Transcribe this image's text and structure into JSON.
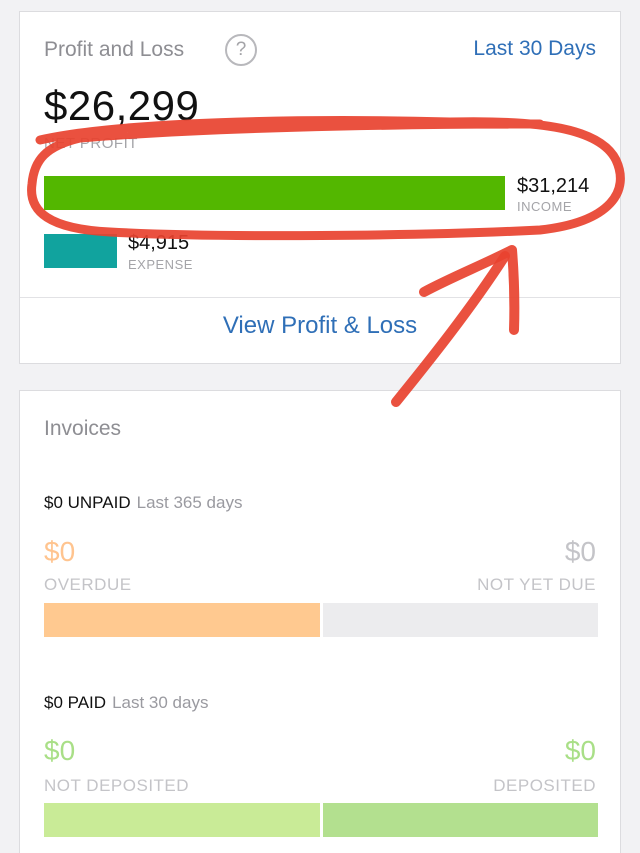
{
  "profit_loss": {
    "title": "Profit and Loss",
    "help_icon": "?",
    "period": "Last 30 Days",
    "net_value": "$26,299",
    "net_label": "NET PROFIT",
    "income": {
      "value": "$31,214",
      "label": "INCOME",
      "amount": 31214,
      "color": "#53b700"
    },
    "expense": {
      "value": "$4,915",
      "label": "EXPENSE",
      "amount": 4915,
      "color": "#11a39e"
    },
    "view_link": "View Profit & Loss"
  },
  "invoices": {
    "title": "Invoices",
    "unpaid": {
      "heading": "$0 UNPAID",
      "range": "Last 365 days",
      "overdue_value": "$0",
      "overdue_label": "OVERDUE",
      "not_due_value": "$0",
      "not_due_label": "NOT YET DUE"
    },
    "paid": {
      "heading": "$0 PAID",
      "range": "Last 30 days",
      "not_deposited_value": "$0",
      "not_deposited_label": "NOT DEPOSITED",
      "deposited_value": "$0",
      "deposited_label": "DEPOSITED"
    }
  },
  "colors": {
    "accent_link": "#2f6fb7",
    "annotation_red": "#e8422f",
    "overdue": "#ffc990",
    "not_deposited": "#c9eb97",
    "deposited": "#b3e08f"
  }
}
